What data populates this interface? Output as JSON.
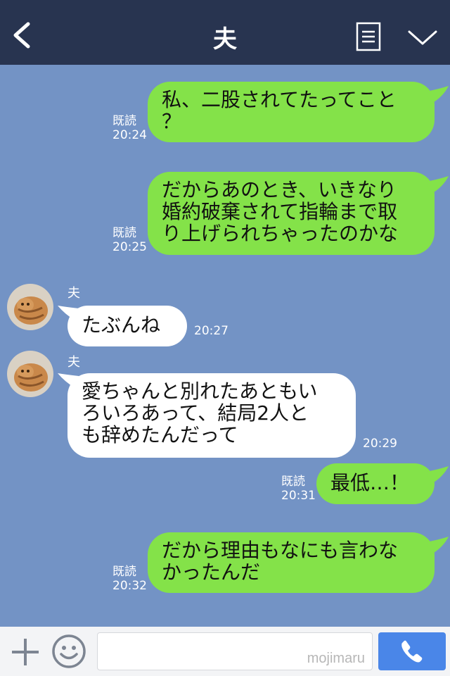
{
  "header": {
    "title": "夫"
  },
  "messages": [
    {
      "read": "既読",
      "time": "20:24",
      "lines": [
        "私、二股されてたってこと",
        "？"
      ]
    },
    {
      "read": "既読",
      "time": "20:25",
      "lines": [
        "だからあのとき、いきなり",
        "婚約破棄されて指輪まで取",
        "り上げられちゃったのかな"
      ]
    },
    {
      "sender": "夫",
      "time": "20:27",
      "lines": [
        "たぶんね"
      ]
    },
    {
      "sender": "夫",
      "time": "20:29",
      "lines": [
        "愛ちゃんと別れたあともい",
        "ろいろあって、結局2人と",
        "も辞めたんだって"
      ]
    },
    {
      "read": "既読",
      "time": "20:31",
      "lines": [
        "最低…！"
      ]
    },
    {
      "read": "既読",
      "time": "20:32",
      "lines": [
        "だから理由もなにも言わな",
        "かったんだ"
      ]
    }
  ],
  "footer": {
    "input_value": "",
    "watermark": "mojimaru"
  },
  "colors": {
    "header": "#283450",
    "background": "#7393c5",
    "outgoing": "#84e249",
    "incoming": "#ffffff",
    "call": "#4a86e8"
  },
  "icons": [
    "back-icon",
    "notes-icon",
    "chevron-down-icon",
    "plus-icon",
    "smile-icon",
    "phone-icon"
  ]
}
